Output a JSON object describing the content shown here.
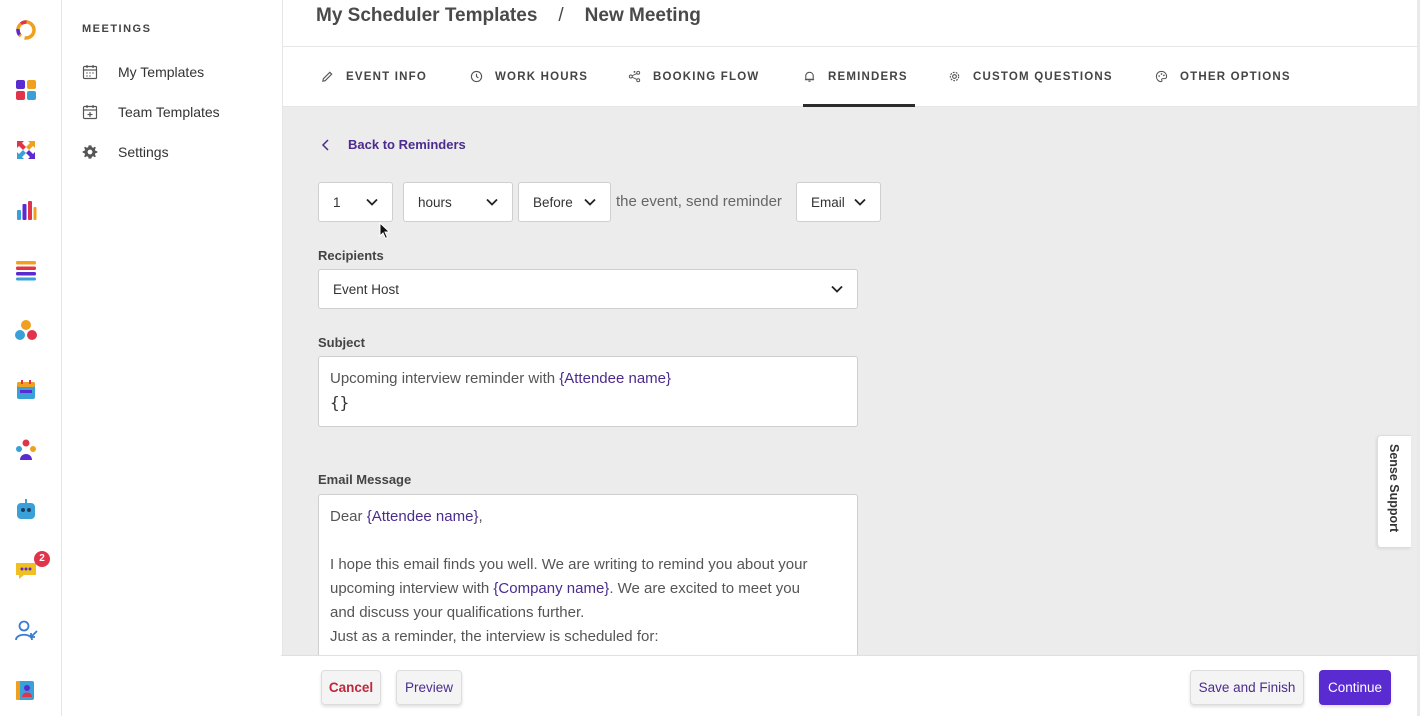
{
  "rail": {
    "badge_count": "2",
    "icons": [
      "logo-icon",
      "dashboard-icon",
      "arrows-icon",
      "bar-chart-icon",
      "list-icon",
      "circles-icon",
      "calendar-icon",
      "team-icon",
      "robot-icon",
      "chat-icon",
      "user-icon",
      "contacts-icon"
    ]
  },
  "sidenav": {
    "heading": "MEETINGS",
    "items": [
      {
        "label": "My Templates",
        "icon": "calendar-icon"
      },
      {
        "label": "Team Templates",
        "icon": "calendar-plus-icon"
      },
      {
        "label": "Settings",
        "icon": "gear-icon"
      }
    ]
  },
  "header": {
    "crumb_parent": "My Scheduler Templates",
    "separator": "/",
    "crumb_current": "New Meeting"
  },
  "tabs": [
    {
      "label": "EVENT INFO",
      "icon": "pencil-icon"
    },
    {
      "label": "WORK HOURS",
      "icon": "clock-icon"
    },
    {
      "label": "BOOKING FLOW",
      "icon": "flow-icon"
    },
    {
      "label": "REMINDERS",
      "icon": "bell-icon",
      "active": true
    },
    {
      "label": "CUSTOM QUESTIONS",
      "icon": "gear-icon"
    },
    {
      "label": "OTHER OPTIONS",
      "icon": "palette-icon"
    }
  ],
  "main": {
    "back_label": "Back to Reminders",
    "amount": "1",
    "unit": "hours",
    "timing": "Before",
    "mid_text": "the event, send reminder",
    "channel": "Email",
    "recipients_label": "Recipients",
    "recipients_value": "Event Host",
    "subject_label": "Subject",
    "subject_text": "Upcoming interview reminder with ",
    "subject_var": "{Attendee name}",
    "subject_braces": "{}",
    "message_label": "Email Message",
    "message": {
      "greeting_prefix": "Dear ",
      "greeting_var": "{Attendee name}",
      "greeting_suffix": ",",
      "line1": "I hope this email finds you well. We are writing to remind you about your",
      "line2_prefix": "upcoming interview with ",
      "line2_var": "{Company name}",
      "line2_suffix": ". We are excited to meet you",
      "line3": "and discuss your qualifications further.",
      "line4": "Just as a reminder, the interview is scheduled for:"
    }
  },
  "support_tab": "Sense Support",
  "footer": {
    "cancel": "Cancel",
    "preview": "Preview",
    "save_finish": "Save and Finish",
    "continue": "Continue"
  },
  "colors": {
    "accent": "#5a2bd0",
    "link": "#4b2c8e",
    "danger": "#c0283b",
    "badge": "#e0344b"
  }
}
